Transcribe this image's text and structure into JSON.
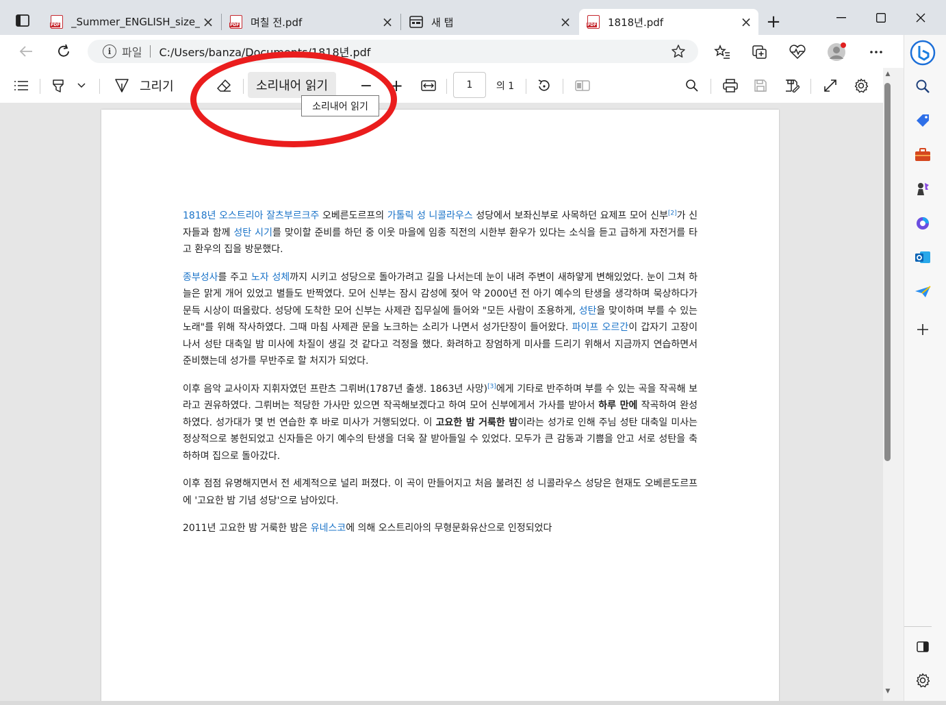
{
  "tabs": [
    {
      "title": "_Summer_ENGLISH_size_xx",
      "type": "pdf",
      "active": false
    },
    {
      "title": "며칠 전.pdf",
      "type": "pdf",
      "active": false
    },
    {
      "title": "새 탭",
      "type": "newtab",
      "active": false
    },
    {
      "title": "1818년.pdf",
      "type": "pdf",
      "active": true
    }
  ],
  "address": {
    "label": "파일",
    "url": "C:/Users/banza/Documents/1818년.pdf"
  },
  "pdf_toolbar": {
    "draw_label": "그리기",
    "read_aloud_label": "소리내어 읽기",
    "zoom_out": "−",
    "zoom_in": "+",
    "page_number": "1",
    "page_count": "의 1",
    "tooltip": "소리내어 읽기"
  },
  "document": {
    "p1": {
      "link1": "1818년",
      "link2": "오스트리아",
      "link3": "잘츠부르크주",
      "t1": " 오베른도르프의 ",
      "link4": "가톨릭 성 니콜라우스",
      "t2": " 성당에서 보좌신부로 사목하던 요제프 모어 신부",
      "ref": "[2]",
      "t3": "가 신자들과 함께 ",
      "link5": "성탄 시기",
      "t4": "를 맞이할 준비를 하던 중 이웃 마을에 임종 직전의 시한부 환우가 있다는 소식을 듣고 급하게 자전거를 타고 환우의 집을 방문했다."
    },
    "p2": {
      "link1": "종부성사",
      "t1": "를 주고 ",
      "link2": "노자 성체",
      "t2": "까지 시키고 성당으로 돌아가려고 길을 나서는데 눈이 내려 주변이 새하얗게 변해있었다. 눈이 그쳐 하늘은 맑게 개어 있었고 별들도 반짝였다. 모어 신부는 잠시 감성에 젖어 약 2000년 전 아기 예수의 탄생을 생각하며 묵상하다가 문득 시상이 떠올랐다. 성당에 도착한 모어 신부는 사제관 집무실에 들어와 \"모든 사람이 조용하게, ",
      "link3": "성탄",
      "t3": "을 맞이하며 부를 수 있는 노래\"를 위해 작사하였다. 그때 마침 사제관 문을 노크하는 소리가 나면서 성가단장이 들어왔다. ",
      "link4": "파이프 오르간",
      "t4": "이 갑자기 고장이 나서 성탄 대축일 밤 미사에 차질이 생길 것 같다고 걱정을 했다. 화려하고 장엄하게 미사를 드리기 위해서 지금까지 연습하면서 준비했는데 성가를 무반주로 할 처지가 되었다."
    },
    "p3": {
      "t1": "이후 음악 교사이자 지휘자였던 프란츠 그뤼버(1787년 출생. 1863년 사망)",
      "ref": "[3]",
      "t2": "에게 기타로 반주하며 부를 수 있는 곡을 작곡해 보라고 권유하였다. 그뤼버는 적당한 가사만 있으면 작곡해보겠다고 하여 모어 신부에게서 가사를 받아서 ",
      "bold1": "하루 만에",
      "t3": " 작곡하여 완성하였다. 성가대가 몇 번 연습한 후 바로 미사가 거행되었다. 이 ",
      "bold2": "고요한 밤 거룩한 밤",
      "t4": "이라는 성가로 인해 주님 성탄 대축일 미사는 정상적으로 봉헌되었고 신자들은 아기 예수의 탄생을 더욱 잘 받아들일 수 있었다. 모두가 큰 감동과 기쁨을 안고 서로 성탄을 축하하며 집으로 돌아갔다."
    },
    "p4": {
      "t1": "이후 점점 유명해지면서 전 세계적으로 널리 퍼졌다. 이 곡이 만들어지고 처음 불려진 성 니콜라우스 성당은 현재도 오베른도르프에 '고요한 밤 기념 성당'으로 남아있다."
    },
    "p5": {
      "t1": "2011년 고요한 밤 거룩한 밤은 ",
      "link1": "유네스코",
      "t2": "에 의해 오스트리아의 무형문화유산으로 인정되었다"
    }
  },
  "sidebar": {
    "icons": [
      "search-icon",
      "tag-icon",
      "briefcase-icon",
      "chess-icon",
      "office-icon",
      "outlook-icon",
      "send-icon",
      "add-icon",
      "split-screen-icon",
      "settings-icon"
    ]
  },
  "colors": {
    "link": "#1a73c8",
    "annotation": "#ea1d1d",
    "tab_strip": "#dfe3e8"
  }
}
